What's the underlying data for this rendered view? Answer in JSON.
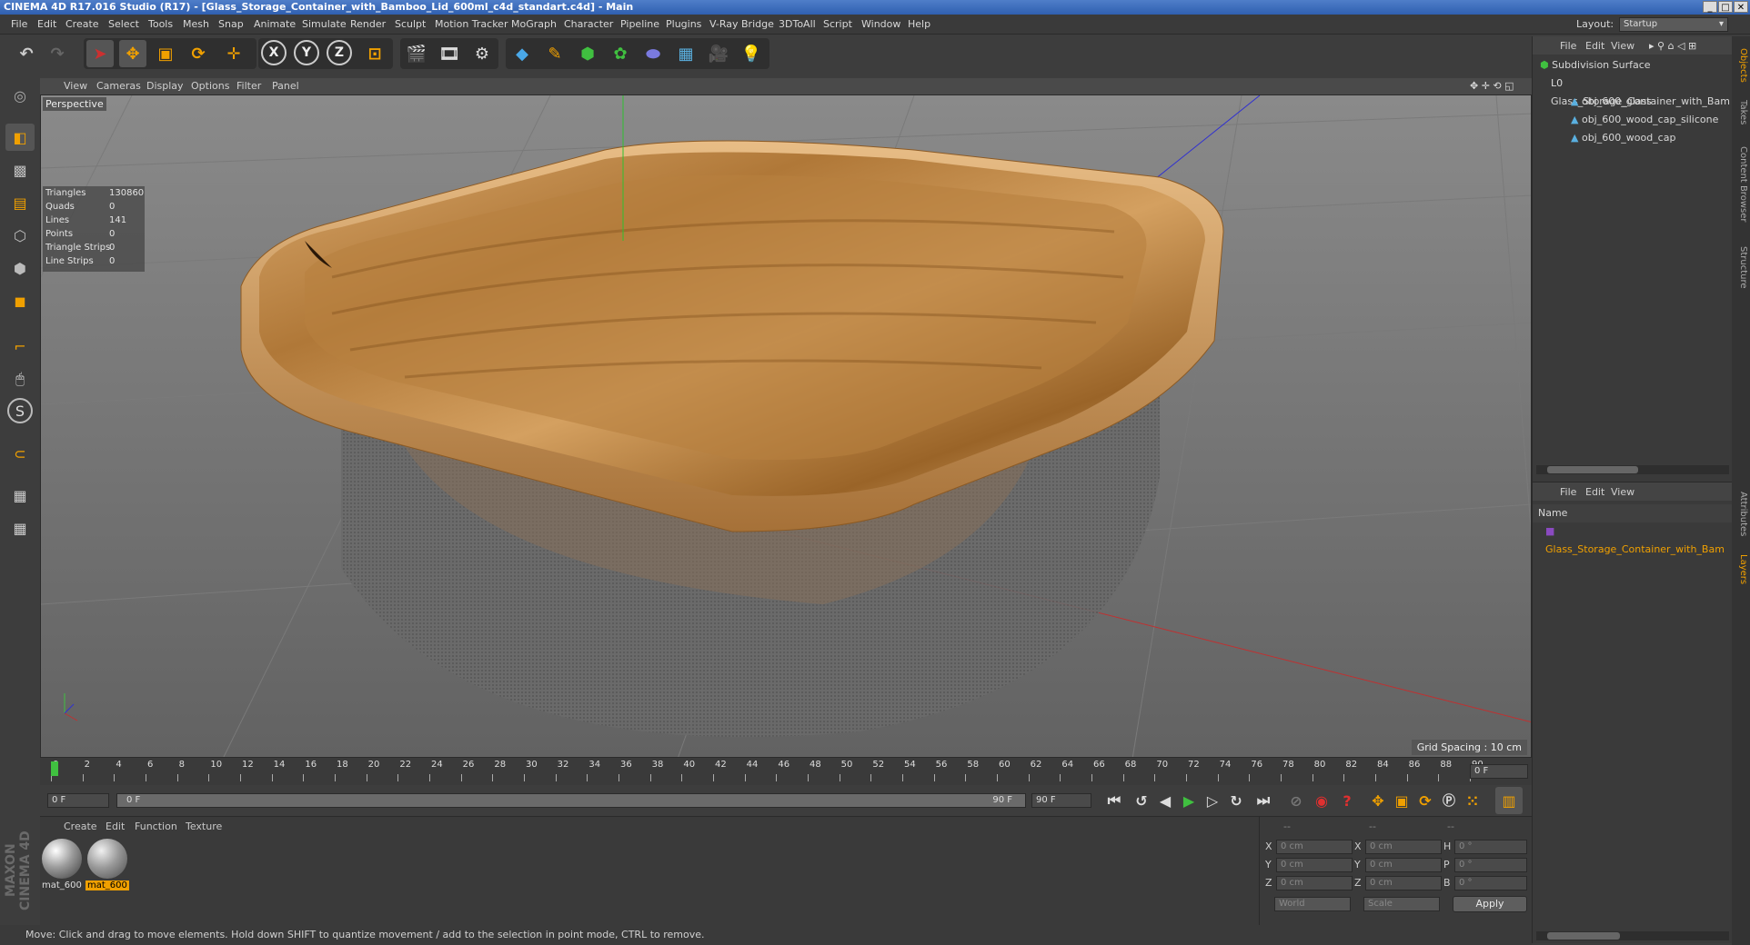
{
  "window": {
    "title": "CINEMA 4D R17.016 Studio (R17) - [Glass_Storage_Container_with_Bamboo_Lid_600ml_c4d_standart.c4d] - Main"
  },
  "menu": {
    "items": [
      "File",
      "Edit",
      "Create",
      "Select",
      "Tools",
      "Mesh",
      "Snap",
      "Animate",
      "Simulate",
      "Render",
      "Sculpt",
      "Motion Tracker",
      "MoGraph",
      "Character",
      "Pipeline",
      "Plugins",
      "V-Ray Bridge",
      "3DToAll",
      "Script",
      "Window",
      "Help"
    ],
    "layout_label": "Layout:",
    "layout_value": "Startup"
  },
  "viewport": {
    "menu": [
      "View",
      "Cameras",
      "Display",
      "Options",
      "Filter",
      "Panel"
    ],
    "label": "Perspective",
    "grid_spacing": "Grid Spacing : 10 cm",
    "stats": [
      {
        "label": "Triangles",
        "value": "130860"
      },
      {
        "label": "Quads",
        "value": "0"
      },
      {
        "label": "Lines",
        "value": "141"
      },
      {
        "label": "Points",
        "value": "0"
      },
      {
        "label": "Triangle Strips",
        "value": "0"
      },
      {
        "label": "Line Strips",
        "value": "0"
      }
    ]
  },
  "timeline": {
    "ticks": [
      "0",
      "2",
      "4",
      "6",
      "8",
      "10",
      "12",
      "14",
      "16",
      "18",
      "20",
      "22",
      "24",
      "26",
      "28",
      "30",
      "32",
      "34",
      "36",
      "38",
      "40",
      "42",
      "44",
      "46",
      "48",
      "50",
      "52",
      "54",
      "56",
      "58",
      "60",
      "62",
      "64",
      "66",
      "68",
      "70",
      "72",
      "74",
      "76",
      "78",
      "80",
      "82",
      "84",
      "86",
      "88",
      "90"
    ],
    "current_frame": "0 F",
    "start_frame": "0 F",
    "range_start": "0 F",
    "range_end": "90 F",
    "end_frame": "90 F"
  },
  "materials": {
    "menu": [
      "Create",
      "Edit",
      "Function",
      "Texture"
    ],
    "items": [
      {
        "name": "mat_600",
        "selected": false
      },
      {
        "name": "mat_600",
        "selected": true
      }
    ],
    "brand": "MAXON CINEMA 4D"
  },
  "coords": {
    "header": [
      "--",
      "--",
      "--"
    ],
    "rows": [
      {
        "a": "X",
        "av": "0 cm",
        "b": "X",
        "bv": "0 cm",
        "c": "H",
        "cv": "0 °"
      },
      {
        "a": "Y",
        "av": "0 cm",
        "b": "Y",
        "bv": "0 cm",
        "c": "P",
        "cv": "0 °"
      },
      {
        "a": "Z",
        "av": "0 cm",
        "b": "Z",
        "bv": "0 cm",
        "c": "B",
        "cv": "0 °"
      }
    ],
    "world": "World",
    "scale": "Scale",
    "apply": "Apply"
  },
  "status": {
    "text": "Move: Click and drag to move elements. Hold down SHIFT to quantize movement / add to the selection in point mode, CTRL to remove."
  },
  "objects": {
    "menu": [
      "File",
      "Edit",
      "View"
    ],
    "tree": [
      {
        "name": "Subdivision Surface",
        "indent": 0
      },
      {
        "name": "Glass_Storage_Container_with_Bam",
        "indent": 1
      },
      {
        "name": "obj_600_glass",
        "indent": 2
      },
      {
        "name": "obj_600_wood_cap_silicone",
        "indent": 2
      },
      {
        "name": "obj_600_wood_cap",
        "indent": 2
      }
    ]
  },
  "layers": {
    "menu": [
      "File",
      "Edit",
      "View"
    ],
    "column": "Name",
    "item": "Glass_Storage_Container_with_Bam"
  },
  "right_tabs": [
    "Objects",
    "Takes",
    "Content Browser",
    "Structure",
    "Attributes",
    "Layers"
  ],
  "colors": {
    "accent": "#f0a000",
    "selection": "#e08a00",
    "frame_marker": "#40c040"
  }
}
